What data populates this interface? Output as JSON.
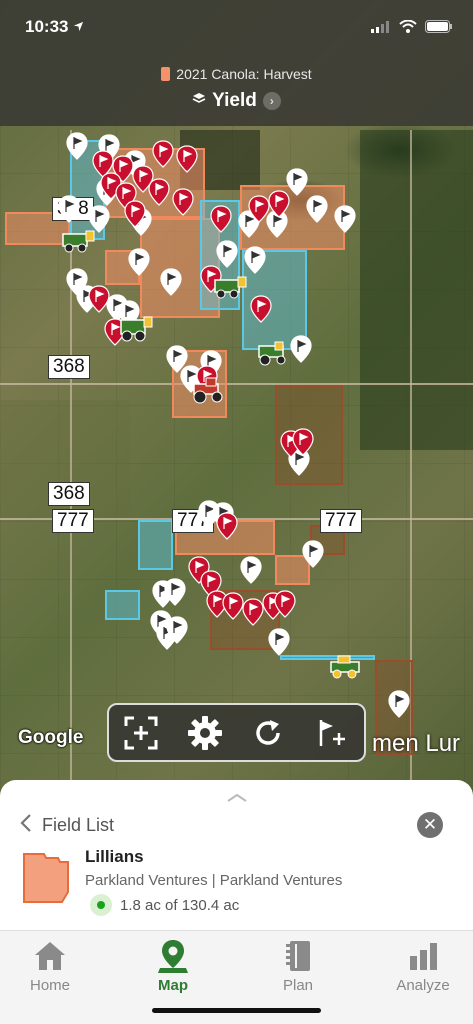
{
  "status": {
    "time": "10:33"
  },
  "header": {
    "season_label": "2021 Canola: Harvest",
    "layer_title": "Yield",
    "season_color": "#f3926b"
  },
  "map": {
    "road_labels": [
      "368",
      "368",
      "368",
      "777",
      "777",
      "777"
    ],
    "google_label": "Google",
    "place_label": "men Lur"
  },
  "toolbar": {
    "icons": [
      "focus-icon",
      "gear-icon",
      "refresh-icon",
      "add-flag-icon"
    ]
  },
  "sheet": {
    "back_label": "Field List",
    "field_name": "Lillians",
    "field_org": "Parkland Ventures | Parkland Ventures",
    "area_text": "1.8 ac of 130.4 ac",
    "field_color": "#f3926b"
  },
  "tabs": [
    {
      "label": "Home",
      "icon": "home-icon"
    },
    {
      "label": "Map",
      "icon": "map-pin-icon",
      "active": true
    },
    {
      "label": "Plan",
      "icon": "notebook-icon"
    },
    {
      "label": "Analyze",
      "icon": "bar-chart-icon"
    }
  ],
  "colors": {
    "accent": "#2e7d32",
    "pin_red": "#c8102e",
    "field_orange": "#f08a5d",
    "field_blue": "#5bc8e6"
  }
}
